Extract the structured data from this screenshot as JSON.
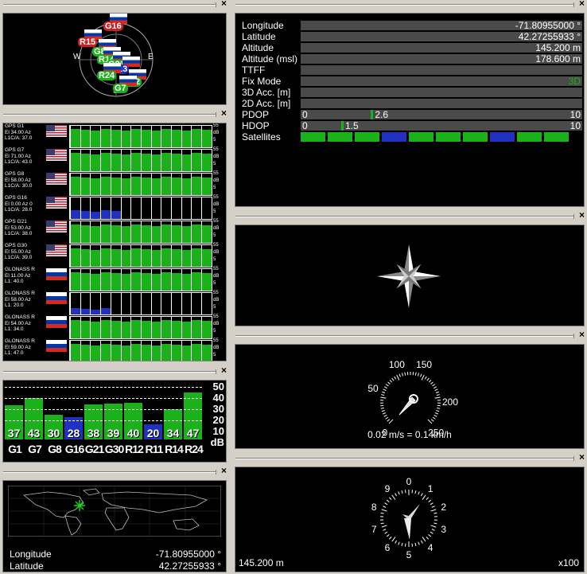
{
  "sky": {
    "dirs": {
      "n": "N",
      "w": "W",
      "e": "E",
      "s": "S"
    },
    "sats": [
      {
        "name": "G16",
        "color": "#cc2020"
      },
      {
        "name": "R15",
        "color": "#cc2020"
      },
      {
        "name": "G8",
        "color": "#1ab11a"
      },
      {
        "name": "R14",
        "color": "#1ab11a"
      },
      {
        "name": "G21",
        "color": "#1ab11a"
      },
      {
        "name": "13",
        "color": "#2030c0"
      },
      {
        "name": "R24",
        "color": "#1ab11a"
      },
      {
        "name": "R12",
        "color": "#1ab11a"
      },
      {
        "name": "G7",
        "color": "#1ab11a"
      }
    ]
  },
  "signal": {
    "max": "55",
    "unit": "dB",
    "min": "5",
    "rows": [
      {
        "label": "GPS G1\nEl 34.00 Az\nL1C/A: 37.0",
        "flag": "us",
        "color": "#1ab11a",
        "level": 0.85,
        "seg": 14
      },
      {
        "label": "GPS G7\nEl 71.00 Az\nL1C/A: 43.0",
        "flag": "us",
        "color": "#1ab11a",
        "level": 0.85,
        "seg": 14
      },
      {
        "label": "GPS G8\nEl 58.00 Az\nL1C/A: 30.0",
        "flag": "us",
        "color": "#1ab11a",
        "level": 0.85,
        "seg": 14
      },
      {
        "label": "GPS G16\nEl 0.00 Az 0\nL1C/A: 28.0",
        "flag": "us",
        "color": "#2030c0",
        "level": 0.4,
        "seg": 5
      },
      {
        "label": "GPS G21\nEl 53.00 Az\nL1C/A: 38.0",
        "flag": "us",
        "color": "#1ab11a",
        "level": 0.85,
        "seg": 14
      },
      {
        "label": "GPS G30\nEl 55.00 Az\nL1C/A: 39.0",
        "flag": "us",
        "color": "#1ab11a",
        "level": 0.85,
        "seg": 14
      },
      {
        "label": "GLONASS R\nEl 11.00 Az\nL1: 40.0",
        "flag": "ru",
        "color": "#1ab11a",
        "level": 0.85,
        "seg": 14
      },
      {
        "label": "GLONASS R\nEl 58.00 Az\nL1: 20.0",
        "flag": "ru",
        "color": "#2030c0",
        "level": 0.3,
        "seg": 4
      },
      {
        "label": "GLONASS R\nEl 54.00 Az\nL1: 34.0",
        "flag": "ru",
        "color": "#1ab11a",
        "level": 0.85,
        "seg": 14
      },
      {
        "label": "GLONASS R\nEl 59.00 Az\nL1: 47.0",
        "flag": "ru",
        "color": "#1ab11a",
        "level": 0.85,
        "seg": 14
      }
    ]
  },
  "snr": {
    "scale": [
      "50",
      "40",
      "30",
      "20",
      "10",
      "dB"
    ],
    "bars": [
      {
        "id": "G1",
        "val": "37",
        "color": "#1ab11a",
        "level": 0.47
      },
      {
        "id": "G7",
        "val": "43",
        "color": "#1ab11a",
        "level": 0.6
      },
      {
        "id": "G8",
        "val": "30",
        "color": "#1ab11a",
        "level": 0.3
      },
      {
        "id": "G16",
        "val": "28",
        "color": "#2030c0",
        "level": 0.26
      },
      {
        "id": "G21",
        "val": "38",
        "color": "#1ab11a",
        "level": 0.48
      },
      {
        "id": "G30",
        "val": "39",
        "color": "#1ab11a",
        "level": 0.5
      },
      {
        "id": "R12",
        "val": "40",
        "color": "#1ab11a",
        "level": 0.52
      },
      {
        "id": "R11",
        "val": "20",
        "color": "#2030c0",
        "level": 0.13
      },
      {
        "id": "R14",
        "val": "34",
        "color": "#1ab11a",
        "level": 0.4
      },
      {
        "id": "R24",
        "val": "47",
        "color": "#1ab11a",
        "level": 0.7
      }
    ]
  },
  "map": {
    "lon_label": "Longitude",
    "lon_value": "-71.80955000 °",
    "lat_label": "Latitude",
    "lat_value": "42.27255933 °"
  },
  "info": {
    "rows": [
      {
        "k": "Longitude",
        "v": "-71.80955000 °"
      },
      {
        "k": "Latitude",
        "v": "42.27255933 °"
      },
      {
        "k": "Altitude",
        "v": "145.200 m"
      },
      {
        "k": "Altitude (msl)",
        "v": "178.600 m"
      },
      {
        "k": "TTFF",
        "v": ""
      },
      {
        "k": "Fix Mode",
        "v": "3D"
      },
      {
        "k": "3D Acc. [m]",
        "v": ""
      },
      {
        "k": "2D Acc. [m]",
        "v": ""
      }
    ],
    "fix_color": "#1ab11a",
    "pdop": {
      "label": "PDOP",
      "min": "0",
      "val": "2.6",
      "max": "10",
      "level": 0.26
    },
    "hdop": {
      "label": "HDOP",
      "min": "0",
      "val": "1.5",
      "max": "10",
      "level": 0.15
    },
    "satellites": {
      "label": "Satellites",
      "colors": [
        "#1ab11a",
        "#1ab11a",
        "#1ab11a",
        "#2030c0",
        "#1ab11a",
        "#1ab11a",
        "#1ab11a",
        "#2030c0",
        "#1ab11a",
        "#1ab11a"
      ]
    }
  },
  "speed": {
    "ticks": [
      "100",
      "150",
      "50",
      "200",
      "0",
      "250"
    ],
    "caption": "0.02 m/s = 0.1 km/h",
    "value": 0
  },
  "altimeter": {
    "ticks": [
      "0",
      "1",
      "2",
      "3",
      "4",
      "5",
      "6",
      "7",
      "8",
      "9"
    ],
    "value_label": "145.200 m",
    "multiplier": "x100"
  }
}
